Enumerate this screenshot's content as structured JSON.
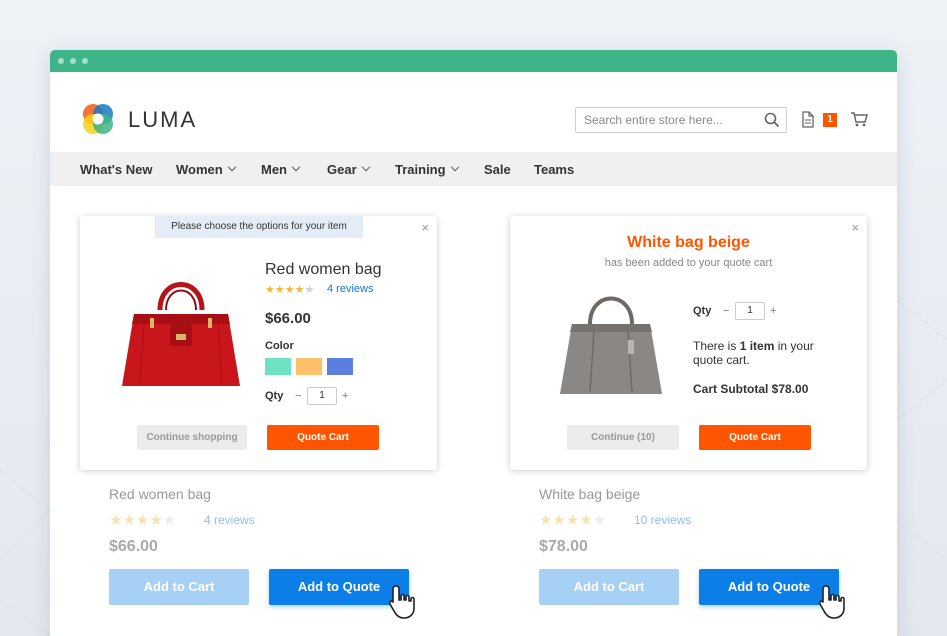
{
  "header": {
    "logo_text": "LUMA",
    "search_placeholder": "Search entire store here...",
    "quote_count": "1"
  },
  "nav": [
    {
      "label": "What's New",
      "has_dropdown": false
    },
    {
      "label": "Women",
      "has_dropdown": true
    },
    {
      "label": "Men",
      "has_dropdown": true
    },
    {
      "label": "Gear",
      "has_dropdown": true
    },
    {
      "label": "Training",
      "has_dropdown": true
    },
    {
      "label": "Sale",
      "has_dropdown": false
    },
    {
      "label": "Teams",
      "has_dropdown": false
    }
  ],
  "options_popup": {
    "notice": "Please choose the options for your item",
    "product_name": "Red women bag",
    "rating_stars": 4,
    "reviews": "4 reviews",
    "price": "$66.00",
    "color_label": "Color",
    "swatches": [
      "#6ee0c4",
      "#ffc06a",
      "#5b7fe0"
    ],
    "qty_label": "Qty",
    "qty_value": "1",
    "minus": "−",
    "plus": "+",
    "continue_label": "Continue shopping",
    "quote_cart_label": "Quote Cart",
    "close": "×"
  },
  "added_popup": {
    "title": "White bag beige",
    "subtitle": "has been added to your quote cart",
    "qty_label": "Qty",
    "qty_value": "1",
    "minus": "−",
    "plus": "+",
    "there_is": "There is",
    "item_count": "1 item",
    "in_your": "in your",
    "quote_cart_text": "quote cart.",
    "subtotal": "Cart Subtotal $78.00",
    "continue_label": "Continue (10)",
    "quote_cart_label": "Quote Cart",
    "close": "×"
  },
  "products": [
    {
      "name": "Red women bag",
      "rating_stars": 4,
      "reviews": "4 reviews",
      "price": "$66.00",
      "add_to_cart": "Add to Cart",
      "add_to_quote": "Add to Quote"
    },
    {
      "name": "White bag beige",
      "rating_stars": 4,
      "reviews": "10 reviews",
      "price": "$78.00",
      "add_to_cart": "Add to Cart",
      "add_to_quote": "Add to Quote"
    }
  ],
  "colors": {
    "accent_green": "#3eb489",
    "orange": "#ff5501",
    "blue": "#0b7ee8",
    "light_blue": "#a6d1f4"
  }
}
